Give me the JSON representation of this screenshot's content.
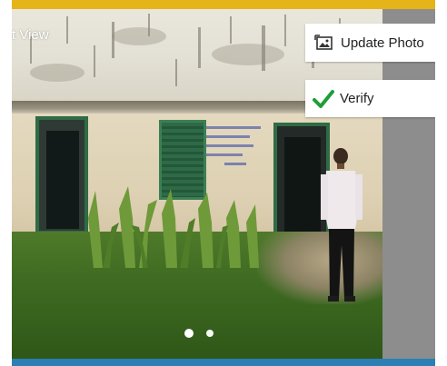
{
  "viewer": {
    "title": "t View",
    "buttons": {
      "update_photo": {
        "label": "Update Photo",
        "icon": "image-icon"
      },
      "verify": {
        "label": "Verify",
        "icon": "checkmark-icon",
        "icon_color": "#1f9d3a"
      }
    },
    "pager": {
      "count": 2,
      "active_index": 0
    }
  },
  "colors": {
    "top_bar": "#e4b418",
    "bottom_bar": "#2b7fb4",
    "side_panel": "#8d8d8d"
  }
}
